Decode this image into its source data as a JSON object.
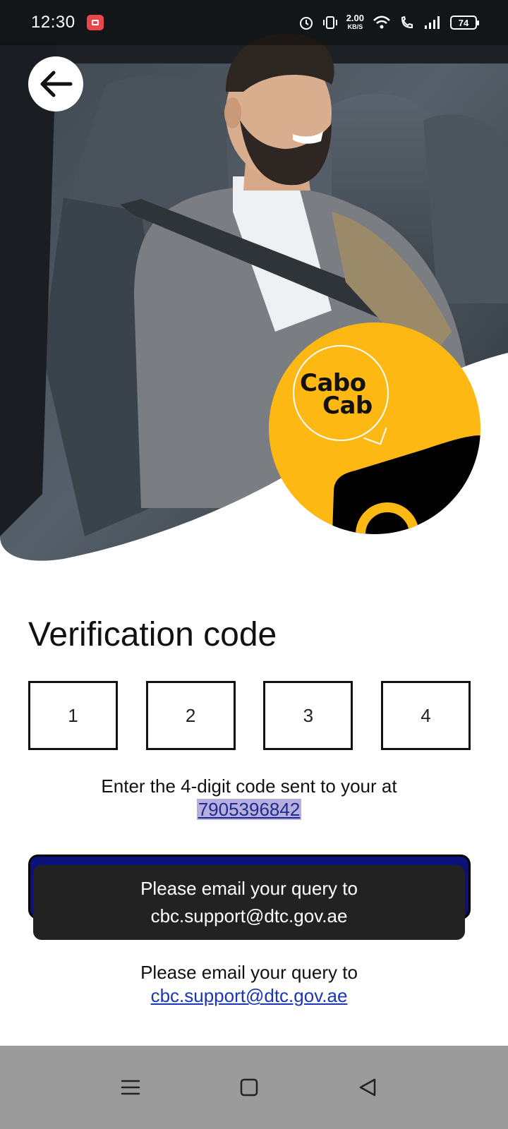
{
  "status_bar": {
    "time": "12:30",
    "speed_value": "2.00",
    "speed_unit": "KB/S",
    "battery": "74",
    "icons": [
      "screen-record-icon",
      "alarm-icon",
      "vibrate-icon",
      "wifi-icon",
      "wifi-call-icon",
      "signal-icon",
      "battery-icon"
    ]
  },
  "logo": {
    "line1": "Cabo",
    "line2": "Cab",
    "color": "#fdb813"
  },
  "verification": {
    "title": "Verification code",
    "digits": [
      "1",
      "2",
      "3",
      "4"
    ],
    "hint_text": "Enter the 4-digit code sent to your at",
    "phone_number": "7905396842"
  },
  "toast": {
    "line1": "Please email your query to",
    "line2": "cbc.support@dtc.gov.ae"
  },
  "support": {
    "text": "Please email your query to",
    "email": "cbc.support@dtc.gov.ae"
  },
  "colors": {
    "accent_button": "#0a117a",
    "brand_yellow": "#fdb813",
    "toast_bg": "#222222",
    "nav_bar": "#9b9b9b"
  },
  "nav_bar": {
    "icons": [
      "menu-icon",
      "home-square-icon",
      "back-triangle-icon"
    ]
  }
}
